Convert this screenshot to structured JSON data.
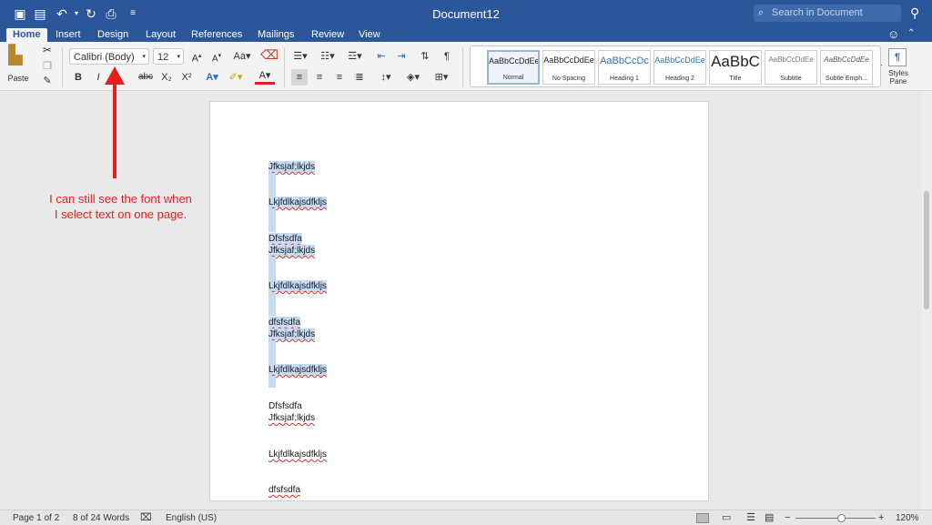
{
  "window": {
    "title": "Document12",
    "search_placeholder": "Search in Document"
  },
  "tabs": [
    "Home",
    "Insert",
    "Design",
    "Layout",
    "References",
    "Mailings",
    "Review",
    "View"
  ],
  "ribbon": {
    "paste_label": "Paste",
    "font_name": "Calibri (Body)",
    "font_size": "12",
    "bold": "B",
    "italic": "I",
    "strike": "abc",
    "subscript": "X₂",
    "superscript": "X²",
    "styles": [
      {
        "sample": "AaBbCcDdEe",
        "label": "Normal"
      },
      {
        "sample": "AaBbCcDdEe",
        "label": "No Spacing"
      },
      {
        "sample": "AaBbCcDc",
        "label": "Heading 1"
      },
      {
        "sample": "AaBbCcDdEe",
        "label": "Heading 2"
      },
      {
        "sample": "AaBbC",
        "label": "Title"
      },
      {
        "sample": "AaBbCcDdEe",
        "label": "Subtitle"
      },
      {
        "sample": "AaBbCcDdEe",
        "label": "Subtle Emph..."
      }
    ],
    "styles_pane_label": "Styles Pane"
  },
  "annotation": {
    "text_line1": "I can still see the font when",
    "text_line2": "I select text on one page."
  },
  "document": {
    "lines": [
      "Jfksjaf;lkjds",
      "Lkjfdlkajsdfkljs",
      "Dfsfsdfa",
      "Jfksjaf;lkjds",
      "Lkjfdlkajsdfkljs",
      "dfsfsdfa",
      "Jfksjaf;lkjds",
      "Lkjfdlkajsdfkljs",
      "Dfsfsdfa",
      "Jfksjaf;lkjds",
      "Lkjfdlkajsdfkljs",
      "dfsfsdfa"
    ]
  },
  "status": {
    "page": "Page 1 of 2",
    "words": "8 of 24 Words",
    "language": "English (US)",
    "zoom": "120%"
  },
  "colors": {
    "accent": "#2b579a",
    "selection": "#c6dcf5",
    "annotation": "#e41f1f"
  }
}
